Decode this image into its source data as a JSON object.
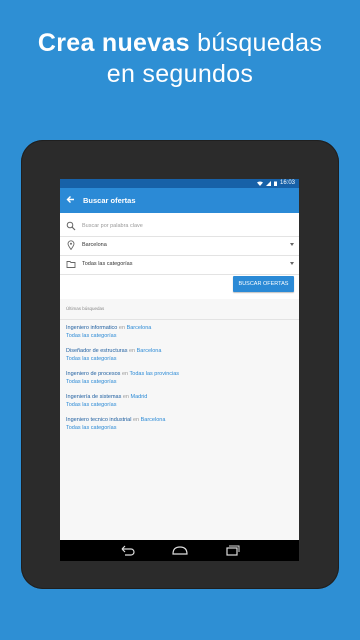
{
  "headline": {
    "line1_bold": "Crea nuevas",
    "line1_light": "búsquedas",
    "line2": "en segundos"
  },
  "statusbar": {
    "time": "16:03"
  },
  "appbar": {
    "title": "Buscar ofertas"
  },
  "search": {
    "keyword_placeholder": "Buscar por palabra clave",
    "location_value": "Barcelona",
    "category_value": "Todas las categorías",
    "button_label": "BUSCAR OFERTAS"
  },
  "recent": {
    "header": "Últimas búsquedas",
    "items": [
      {
        "keyword": "Ingeniero informatico",
        "connector": "en",
        "location": "Barcelona",
        "category": "Todas las categorías"
      },
      {
        "keyword": "Diseñador de estructuras",
        "connector": "en",
        "location": "Barcelona",
        "category": "Todas las categorías"
      },
      {
        "keyword": "Ingeniero de procesos",
        "connector": "en",
        "location": "Todas las provincias",
        "category": "Todas las categorías"
      },
      {
        "keyword": "Ingeniería de sistemas",
        "connector": "en",
        "location": "Madrid",
        "category": "Todas las categorías"
      },
      {
        "keyword": "Ingeniero tecnico industrial",
        "connector": "en",
        "location": "Barcelona",
        "category": "Todas las categorías"
      }
    ]
  },
  "colors": {
    "background": "#2e8fd4",
    "accent": "#2b8ad6",
    "statusbar": "#1761a8"
  },
  "icons": {
    "back": "arrow-back-icon",
    "search": "search-icon",
    "location": "location-pin-icon",
    "category": "folder-icon",
    "wifi": "wifi-icon",
    "signal": "signal-icon",
    "battery": "battery-icon",
    "nav_back": "nav-back-icon",
    "nav_home": "nav-home-icon",
    "nav_recents": "nav-recents-icon"
  }
}
